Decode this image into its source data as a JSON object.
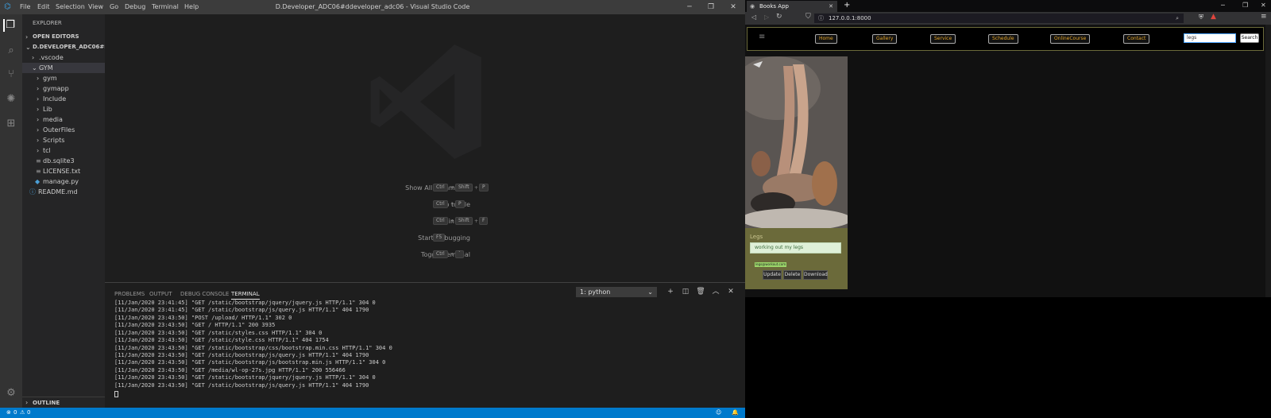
{
  "vscode": {
    "menu": [
      "File",
      "Edit",
      "Selection",
      "View",
      "Go",
      "Debug",
      "Terminal",
      "Help"
    ],
    "window_title": "D.Developer_ADC06#ddeveloper_adc06 - Visual Studio Code",
    "explorer_header": "EXPLORER",
    "open_editors": "OPEN EDITORS",
    "folder_root": "D.DEVELOPER_ADC06#DDE...",
    "tree": [
      {
        "label": ".vscode",
        "type": "folder"
      },
      {
        "label": "GYM",
        "type": "folder-open"
      },
      {
        "label": "gym",
        "type": "folder"
      },
      {
        "label": "gymapp",
        "type": "folder"
      },
      {
        "label": "Include",
        "type": "folder"
      },
      {
        "label": "Lib",
        "type": "folder"
      },
      {
        "label": "media",
        "type": "folder"
      },
      {
        "label": "OuterFiles",
        "type": "folder"
      },
      {
        "label": "Scripts",
        "type": "folder"
      },
      {
        "label": "tcl",
        "type": "folder"
      },
      {
        "label": "db.sqlite3",
        "type": "file"
      },
      {
        "label": "LICENSE.txt",
        "type": "file"
      },
      {
        "label": "manage.py",
        "type": "python-file"
      },
      {
        "label": "README.md",
        "type": "info-file"
      }
    ],
    "outline": "OUTLINE",
    "shortcuts": [
      {
        "label": "Show All Commands",
        "keys": [
          "Ctrl",
          "Shift",
          "P"
        ]
      },
      {
        "label": "Go to File",
        "keys": [
          "Ctrl",
          "P"
        ]
      },
      {
        "label": "Find in Files",
        "keys": [
          "Ctrl",
          "Shift",
          "F"
        ]
      },
      {
        "label": "Start Debugging",
        "keys": [
          "F5"
        ]
      },
      {
        "label": "Toggle Terminal",
        "keys": [
          "Ctrl",
          "`"
        ]
      }
    ],
    "panel_tabs": [
      "PROBLEMS",
      "OUTPUT",
      "DEBUG CONSOLE",
      "TERMINAL"
    ],
    "terminal_select": "1: python",
    "terminal_lines": [
      "[11/Jan/2020 23:41:45] \"GET /static/bootstrap/jquery/jquery.js HTTP/1.1\" 304 0",
      "[11/Jan/2020 23:41:45] \"GET /static/bootstrap/js/query.js HTTP/1.1\" 404 1790",
      "[11/Jan/2020 23:43:50] \"POST /upload/ HTTP/1.1\" 302 0",
      "[11/Jan/2020 23:43:50] \"GET / HTTP/1.1\" 200 3935",
      "[11/Jan/2020 23:43:50] \"GET /static/styles.css HTTP/1.1\" 304 0",
      "[11/Jan/2020 23:43:50] \"GET /static/style.css HTTP/1.1\" 404 1754",
      "[11/Jan/2020 23:43:50] \"GET /static/bootstrap/css/bootstrap.min.css HTTP/1.1\" 304 0",
      "[11/Jan/2020 23:43:50] \"GET /static/bootstrap/js/query.js HTTP/1.1\" 404 1790",
      "[11/Jan/2020 23:43:50] \"GET /static/bootstrap/js/bootstrap.min.js HTTP/1.1\" 304 0",
      "[11/Jan/2020 23:43:50] \"GET /media/wl-op-27s.jpg HTTP/1.1\" 200 556466",
      "[11/Jan/2020 23:43:50] \"GET /static/bootstrap/jquery/jquery.js HTTP/1.1\" 304 0",
      "[11/Jan/2020 23:43:50] \"GET /static/bootstrap/js/query.js HTTP/1.1\" 404 1790"
    ],
    "status_errors": "0",
    "status_warnings": "0"
  },
  "browser": {
    "tab_title": "Books App",
    "url": "127.0.0.1:8000",
    "nav_buttons": [
      "Home",
      "Gallery",
      "Service",
      "Schedule",
      "OnlineCourse",
      "Contact"
    ],
    "search_value": "legs",
    "search_button": "Search",
    "card": {
      "title": "Legs",
      "description": "working out my legs",
      "tag": "legs@workout.com",
      "buttons": [
        "Update",
        "Delete",
        "Download"
      ]
    }
  },
  "colors": {
    "vscode_status": "#007acc",
    "nav_text": "#e3a52a",
    "card_bg": "#6b6a3a"
  }
}
